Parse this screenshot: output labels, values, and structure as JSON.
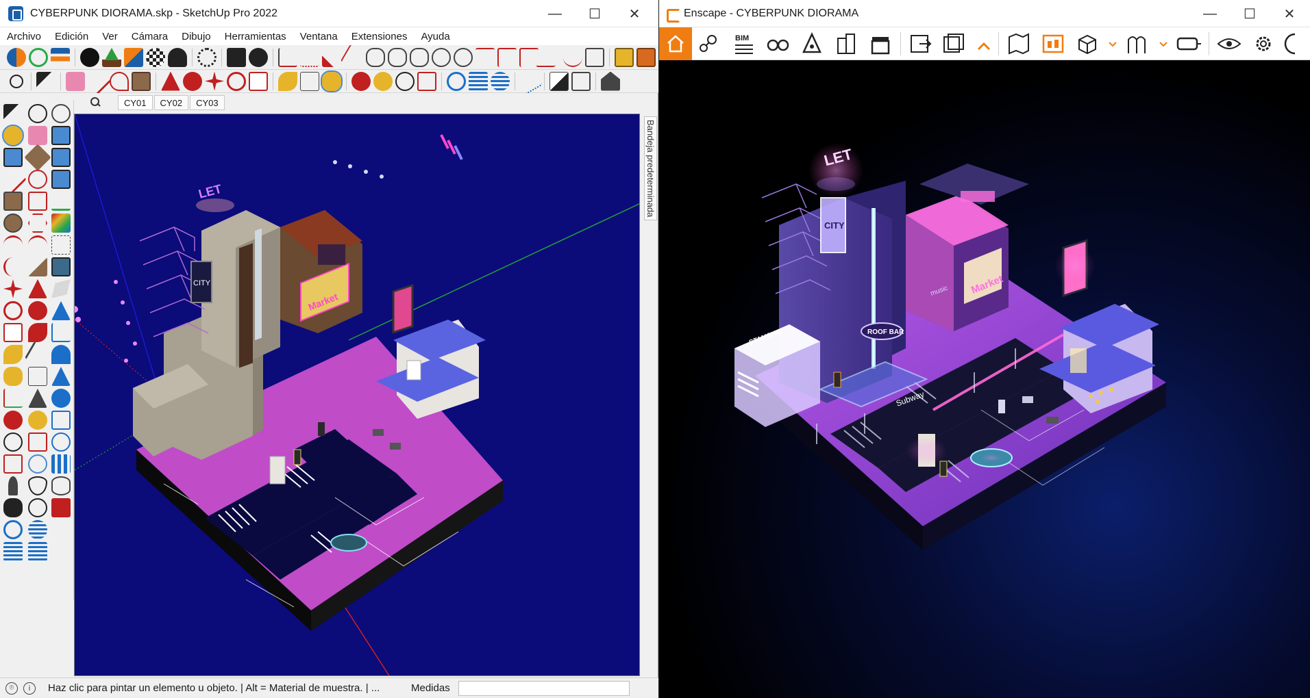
{
  "sketchup": {
    "window_title": "CYBERPUNK DIORAMA.skp - SketchUp Pro 2022",
    "window_controls": {
      "minimize": "—",
      "maximize": "☐",
      "close": "✕"
    },
    "menu": [
      "Archivo",
      "Edición",
      "Ver",
      "Cámara",
      "Dibujo",
      "Herramientas",
      "Ventana",
      "Extensiones",
      "Ayuda"
    ],
    "scenes": [
      "CY01",
      "CY02",
      "CY03"
    ],
    "tray_label": "Bandeja predeterminada",
    "status_text": "Haz clic para pintar un elemento u objeto. | Alt = Material de muestra. | ...",
    "measurements_label": "Medidas",
    "measurements_value": "",
    "model_signs": {
      "let": "LET",
      "city": "CITY",
      "market": "Market"
    },
    "colors": {
      "viewport_bg": "#0b0b7a",
      "ground": "#c04cc8",
      "road": "#0a0a40"
    }
  },
  "enscape": {
    "window_title": "Enscape - CYBERPUNK DIORAMA",
    "window_controls": {
      "minimize": "—",
      "maximize": "☐",
      "close": "✕"
    },
    "toolbar_icons": [
      "home-icon",
      "pin-icon",
      "bim-icon",
      "binoculars-icon",
      "light-icon",
      "buildings-icon",
      "clapper-icon",
      "export-image-icon",
      "batch-export-icon",
      "collapse-chevron-icon",
      "map-icon",
      "asset-library-icon",
      "cube-icon",
      "material-icon",
      "vr-headset-icon",
      "visual-settings-icon",
      "settings-icon"
    ],
    "bim_label": "BIM",
    "render_signs": {
      "let": "LET",
      "city": "CITY",
      "roof_bar": "ROOF BAR",
      "market": "Market",
      "subway": "Subway",
      "stamshil": "STAMSHIL",
      "music": "music"
    },
    "colors": {
      "accent": "#f07d12",
      "viewport_bg": "#000000",
      "neon_pink": "#ff48c8",
      "neon_purple": "#9b4dff"
    }
  }
}
